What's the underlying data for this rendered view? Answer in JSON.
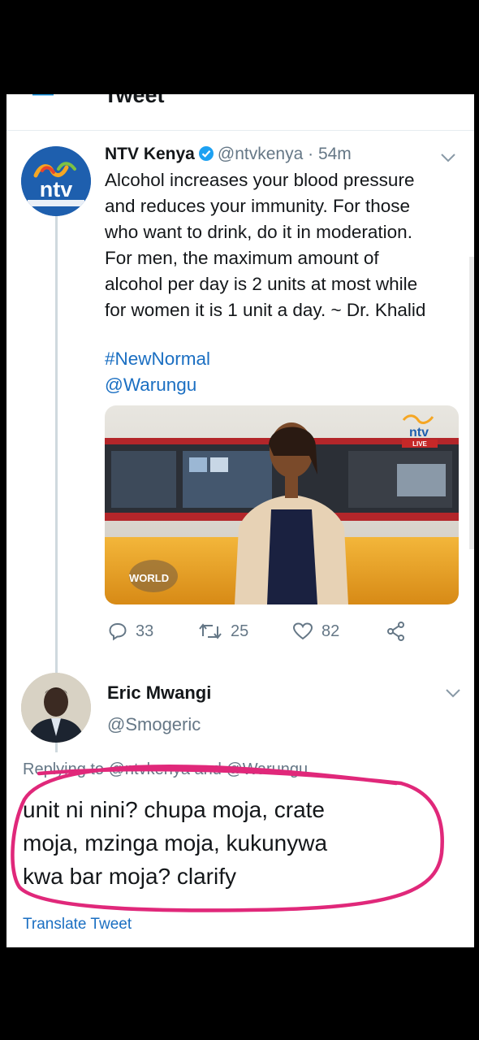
{
  "header": {
    "title": "Tweet"
  },
  "tweet": {
    "author_name": "NTV Kenya",
    "author_handle": "@ntvkenya",
    "separator": "·",
    "time": "54m",
    "avatar_logo_text": "ntv",
    "lines": [
      "Alcohol increases your blood pressure",
      "and reduces your immunity. For those",
      "who want to drink, do it in moderation.",
      "For men, the maximum amount of",
      "alcohol per day is 2 units at most while",
      "for women it is 1 unit a day. ~ Dr. Khalid"
    ],
    "hashtag": "#NewNormal",
    "mention": "@Warungu",
    "media": {
      "channel_logo": "ntv",
      "live_label": "LIVE",
      "show_logo": "WORLD"
    },
    "actions": {
      "replies": "33",
      "retweets": "25",
      "likes": "82"
    }
  },
  "reply": {
    "author_name": "Eric Mwangi",
    "author_handle": "@Smogeric",
    "replying_to": "Replying to @ntvkenya and @Warungu",
    "lines": [
      "unit ni nini? chupa moja, crate",
      "moja, mzinga moja, kukunywa",
      "kwa bar moja? clarify"
    ],
    "translate": "Translate Tweet"
  },
  "colors": {
    "accent": "#1b6fc2",
    "muted": "#657786",
    "annotation": "#e0287a",
    "ntv_blue": "#1e5fae"
  }
}
